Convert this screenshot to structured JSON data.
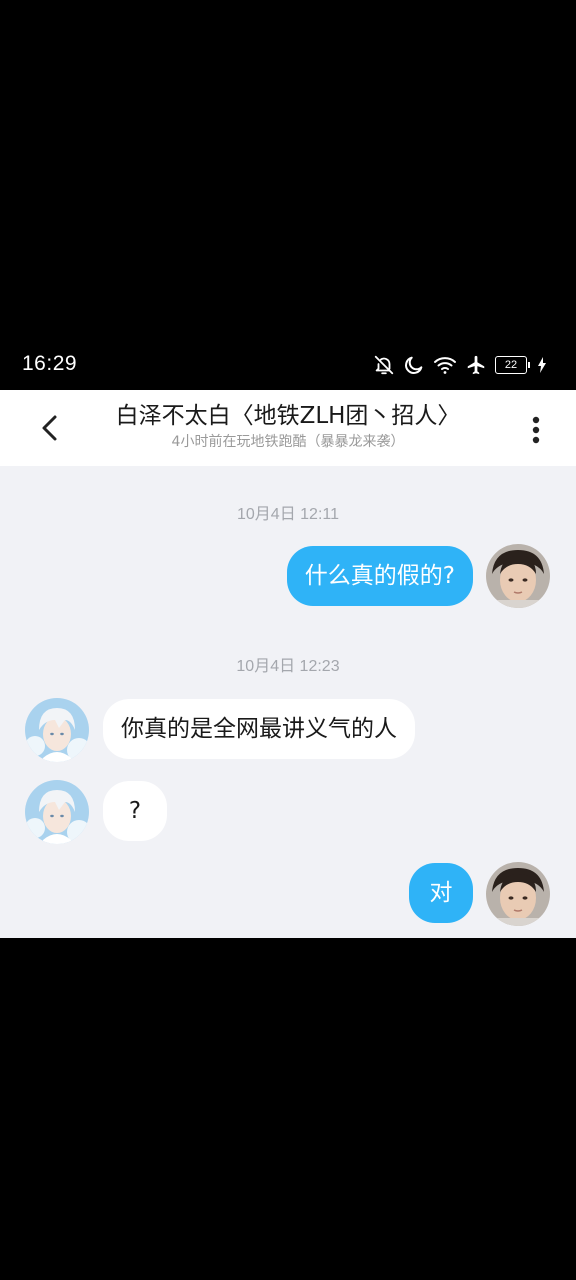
{
  "status_bar": {
    "time": "16:29",
    "battery_level": "22",
    "icons": [
      "bell-off-icon",
      "moon-icon",
      "wifi-icon",
      "airplane-icon",
      "battery-icon",
      "charging-icon"
    ]
  },
  "header": {
    "title": "白泽不太白〈地铁ZLH团丶招人〉",
    "subtitle": "4小时前在玩地铁跑酷（暴暴龙来袭）",
    "back_icon": "chevron-left-icon",
    "more_icon": "more-vertical-icon"
  },
  "colors": {
    "outgoing_bubble": "#2fb3f7",
    "incoming_bubble": "#ffffff",
    "chat_background": "#f1f2f6"
  },
  "messages": {
    "ts1": "10月4日 12:11",
    "m1": "什么真的假的?",
    "ts2": "10月4日 12:23",
    "m2": "你真的是全网最讲义气的人",
    "m3": "?",
    "m4": "对"
  }
}
